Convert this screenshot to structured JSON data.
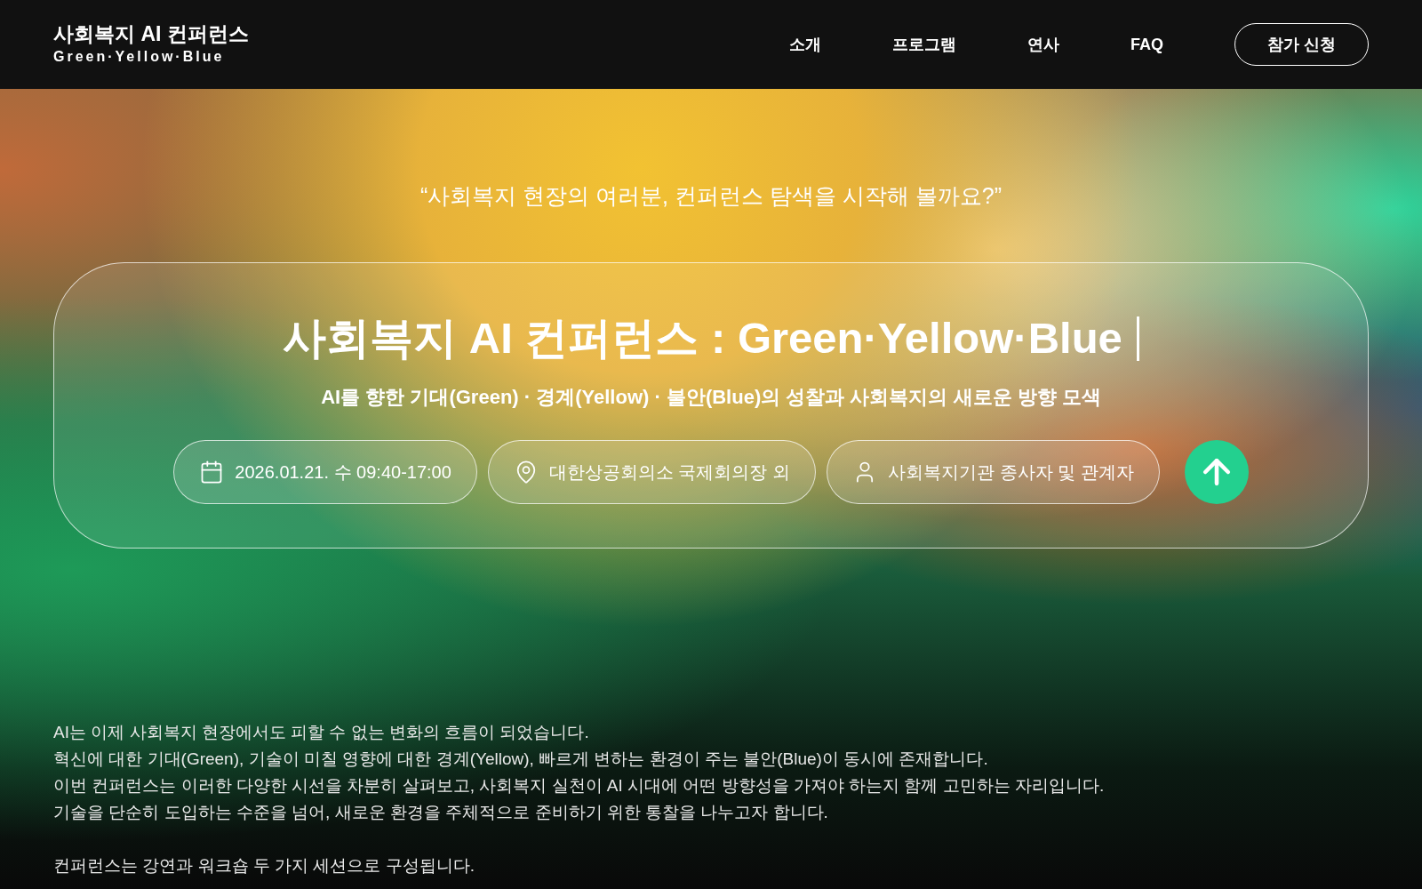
{
  "header": {
    "logo_title": "사회복지 AI 컨퍼런스",
    "logo_subtitle": "Green·Yellow·Blue",
    "nav": [
      "소개",
      "프로그램",
      "연사",
      "FAQ"
    ],
    "cta": "참가 신청"
  },
  "hero": {
    "quote": "“사회복지 현장의 여러분, 컨퍼런스 탐색을 시작해 볼까요?”",
    "title": "사회복지 AI 컨퍼런스 : Green·Yellow·Blue",
    "subtitle": "AI를 향한 기대(Green) · 경계(Yellow) · 불안(Blue)의 성찰과 사회복지의 새로운 방향 모색",
    "info": [
      {
        "kind": "date",
        "text": "2026.01.21. 수 09:40-17:00"
      },
      {
        "kind": "place",
        "text": "대한상공회의소 국제회의장 외"
      },
      {
        "kind": "audience",
        "text": "사회복지기관 종사자 및 관계자"
      }
    ]
  },
  "intro": {
    "paragraphs": [
      [
        "AI는 이제 사회복지 현장에서도 피할 수 없는 변화의 흐름이 되었습니다.",
        "혁신에 대한 기대(Green), 기술이 미칠 영향에 대한 경계(Yellow), 빠르게 변하는 환경이 주는 불안(Blue)이 동시에 존재합니다.",
        "이번 컨퍼런스는 이러한 다양한 시선을 차분히 살펴보고, 사회복지 실천이 AI 시대에 어떤 방향성을 가져야 하는지 함께 고민하는 자리입니다.",
        "기술을 단순히 도입하는 수준을 넘어, 새로운 환경을 주체적으로 준비하기 위한 통찰을 나누고자 합니다."
      ],
      [
        "컨퍼런스는 강연과 워크숍 두 가지 세션으로 구성됩니다."
      ]
    ]
  }
}
